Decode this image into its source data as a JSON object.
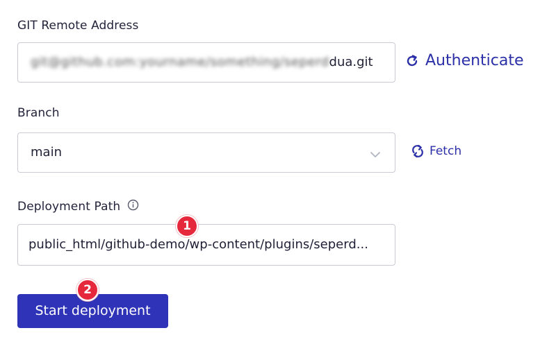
{
  "git": {
    "label": "GIT Remote Address",
    "value_suffix": "dua.git",
    "authenticate_label": "Authenticate"
  },
  "branch": {
    "label": "Branch",
    "value": "main",
    "fetch_label": "Fetch"
  },
  "deployment": {
    "label": "Deployment Path",
    "value": "public_html/github-demo/wp-content/plugins/seperd..."
  },
  "badges": {
    "first": "1",
    "second": "2"
  },
  "actions": {
    "start_label": "Start deployment"
  },
  "colors": {
    "accent": "#2e33b8",
    "link": "#2b2fa8",
    "badge": "#e6283c",
    "border": "#c9cbd4"
  },
  "icons": {
    "authenticate": "refresh-icon",
    "fetch": "sync-icon",
    "info": "info-icon",
    "dropdown": "chevron-down-icon"
  }
}
